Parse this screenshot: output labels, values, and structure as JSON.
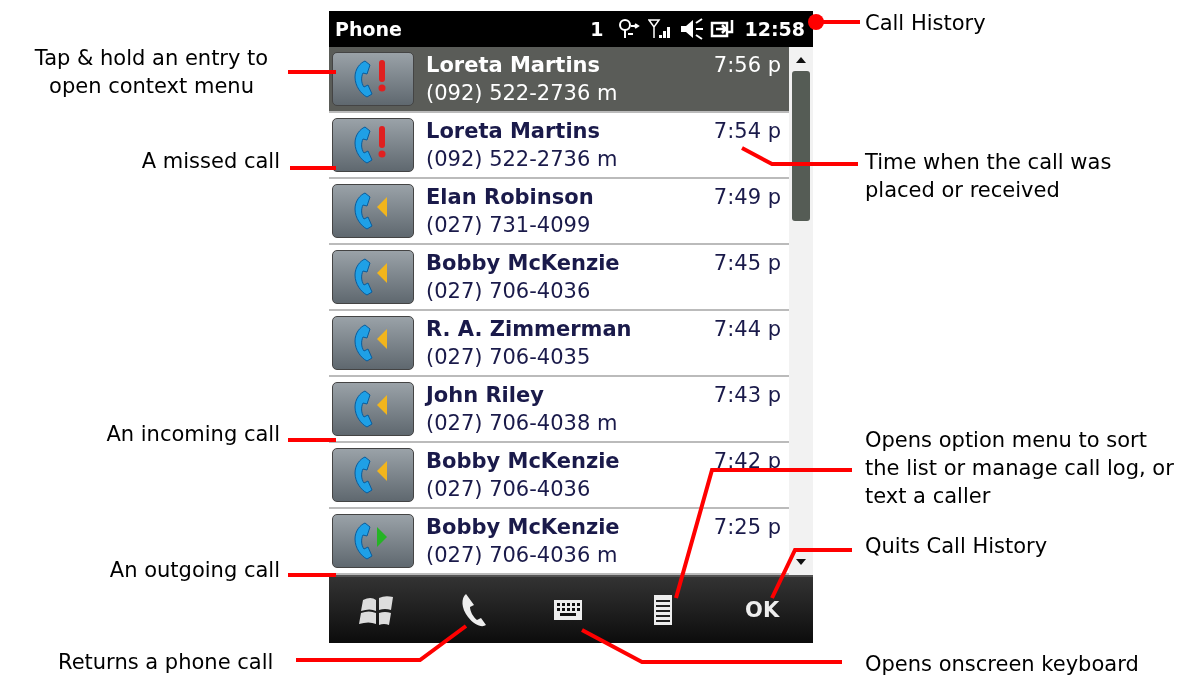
{
  "phone": {
    "status_bar": {
      "title": "Phone",
      "count": "1",
      "clock": "12:58"
    },
    "calls": [
      {
        "name": "Loreta Martins",
        "time": "7:56 p",
        "number": "(092) 522-2736 m",
        "kind": "missed",
        "selected": true
      },
      {
        "name": "Loreta Martins",
        "time": "7:54 p",
        "number": "(092) 522-2736 m",
        "kind": "missed",
        "selected": false
      },
      {
        "name": "Elan Robinson",
        "time": "7:49 p",
        "number": "(027) 731-4099",
        "kind": "incoming",
        "selected": false
      },
      {
        "name": "Bobby McKenzie",
        "time": "7:45 p",
        "number": "(027) 706-4036",
        "kind": "incoming",
        "selected": false
      },
      {
        "name": "R. A. Zimmerman",
        "time": "7:44 p",
        "number": "(027) 706-4035",
        "kind": "incoming",
        "selected": false
      },
      {
        "name": "John Riley",
        "time": "7:43 p",
        "number": "(027) 706-4038 m",
        "kind": "incoming",
        "selected": false
      },
      {
        "name": "Bobby McKenzie",
        "time": "7:42 p",
        "number": "(027) 706-4036",
        "kind": "incoming",
        "selected": false
      },
      {
        "name": "Bobby McKenzie",
        "time": "7:25 p",
        "number": "(027) 706-4036 m",
        "kind": "outgoing",
        "selected": false
      }
    ],
    "softkey_right": "OK"
  },
  "annotations": [
    "Tap & hold an entry to open context menu",
    "A missed call",
    "An incoming call",
    "An outgoing call",
    "Returns a phone call",
    "Call History",
    "Time when the call was placed or received",
    "Opens option menu to sort the list or manage call log, or text a caller",
    "Quits Call History",
    "Opens onscreen keyboard"
  ]
}
